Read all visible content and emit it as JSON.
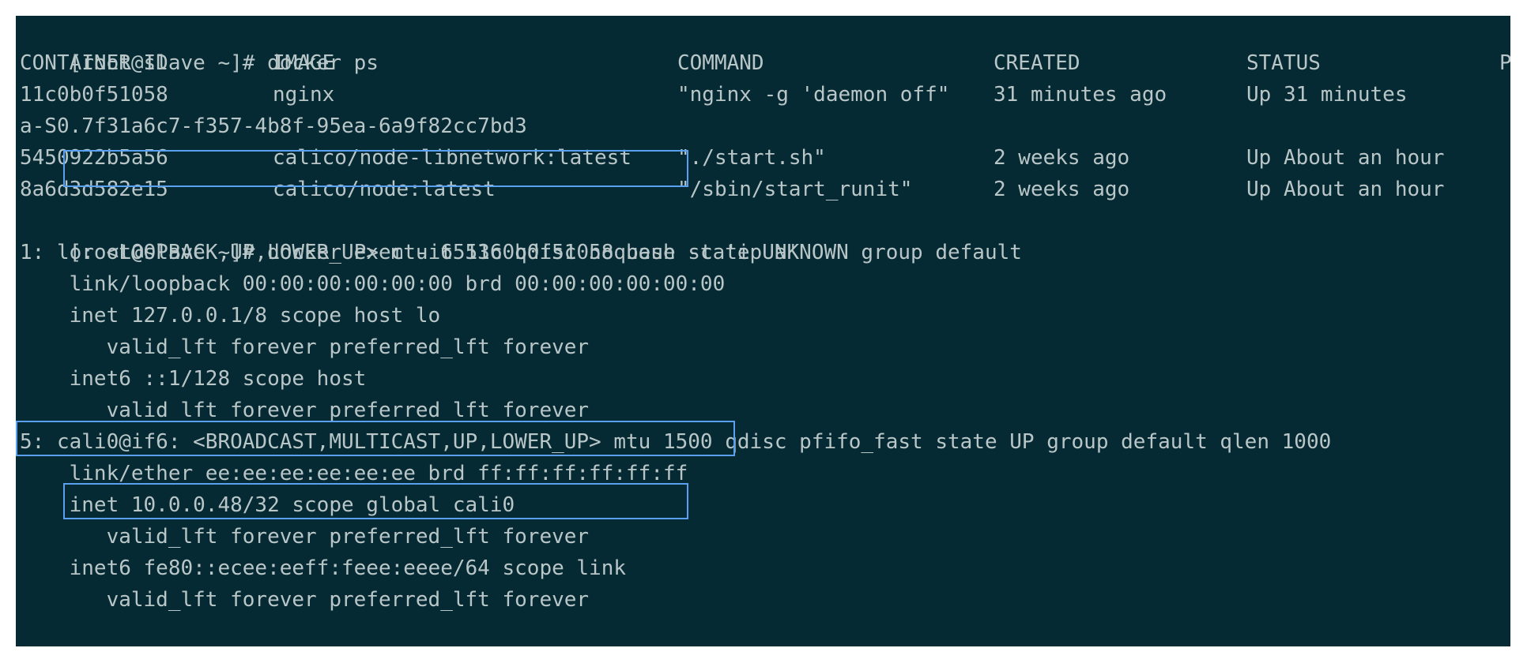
{
  "terminal": {
    "prompt": "[root@slave ~]# ",
    "commands": {
      "docker_ps": "docker ps",
      "docker_exec": "docker exec -it 11c0b0f51058 bash -c 'ip a'"
    },
    "docker_ps": {
      "headers": [
        "CONTAINER ID",
        "IMAGE",
        "COMMAND",
        "CREATED",
        "STATUS",
        "P"
      ],
      "rows": [
        [
          "11c0b0f51058",
          "nginx",
          "\"nginx -g 'daemon off\"",
          "31 minutes ago",
          "Up 31 minutes"
        ],
        [
          "5450922b5a56",
          "calico/node-libnetwork:latest",
          "\"./start.sh\"",
          "2 weeks ago",
          "Up About an hour"
        ],
        [
          "8a6d3d582e15",
          "calico/node:latest",
          "\"/sbin/start_runit\"",
          "2 weeks ago",
          "Up About an hour"
        ]
      ],
      "wrapped_name": "a-S0.7f31a6c7-f357-4b8f-95ea-6a9f82cc7bd3"
    },
    "ip_output": [
      "1: lo: <LOOPBACK,UP,LOWER_UP> mtu 65536 qdisc noqueue state UNKNOWN group default",
      "    link/loopback 00:00:00:00:00:00 brd 00:00:00:00:00:00",
      "    inet 127.0.0.1/8 scope host lo",
      "       valid_lft forever preferred_lft forever",
      "    inet6 ::1/128 scope host",
      "       valid_lft forever preferred_lft forever",
      "5: cali0@if6: <BROADCAST,MULTICAST,UP,LOWER_UP> mtu 1500 qdisc pfifo_fast state UP group default qlen 1000",
      "    link/ether ee:ee:ee:ee:ee:ee brd ff:ff:ff:ff:ff:ff",
      "    inet 10.0.0.48/32 scope global cali0",
      "       valid_lft forever preferred_lft forever",
      "    inet6 fe80::ecee:eeff:feee:eeee/64 scope link",
      "       valid_lft forever preferred_lft forever"
    ]
  },
  "colors": {
    "background": "#062a33",
    "text": "#b9c6c8",
    "highlight": "#5aa0f0"
  }
}
